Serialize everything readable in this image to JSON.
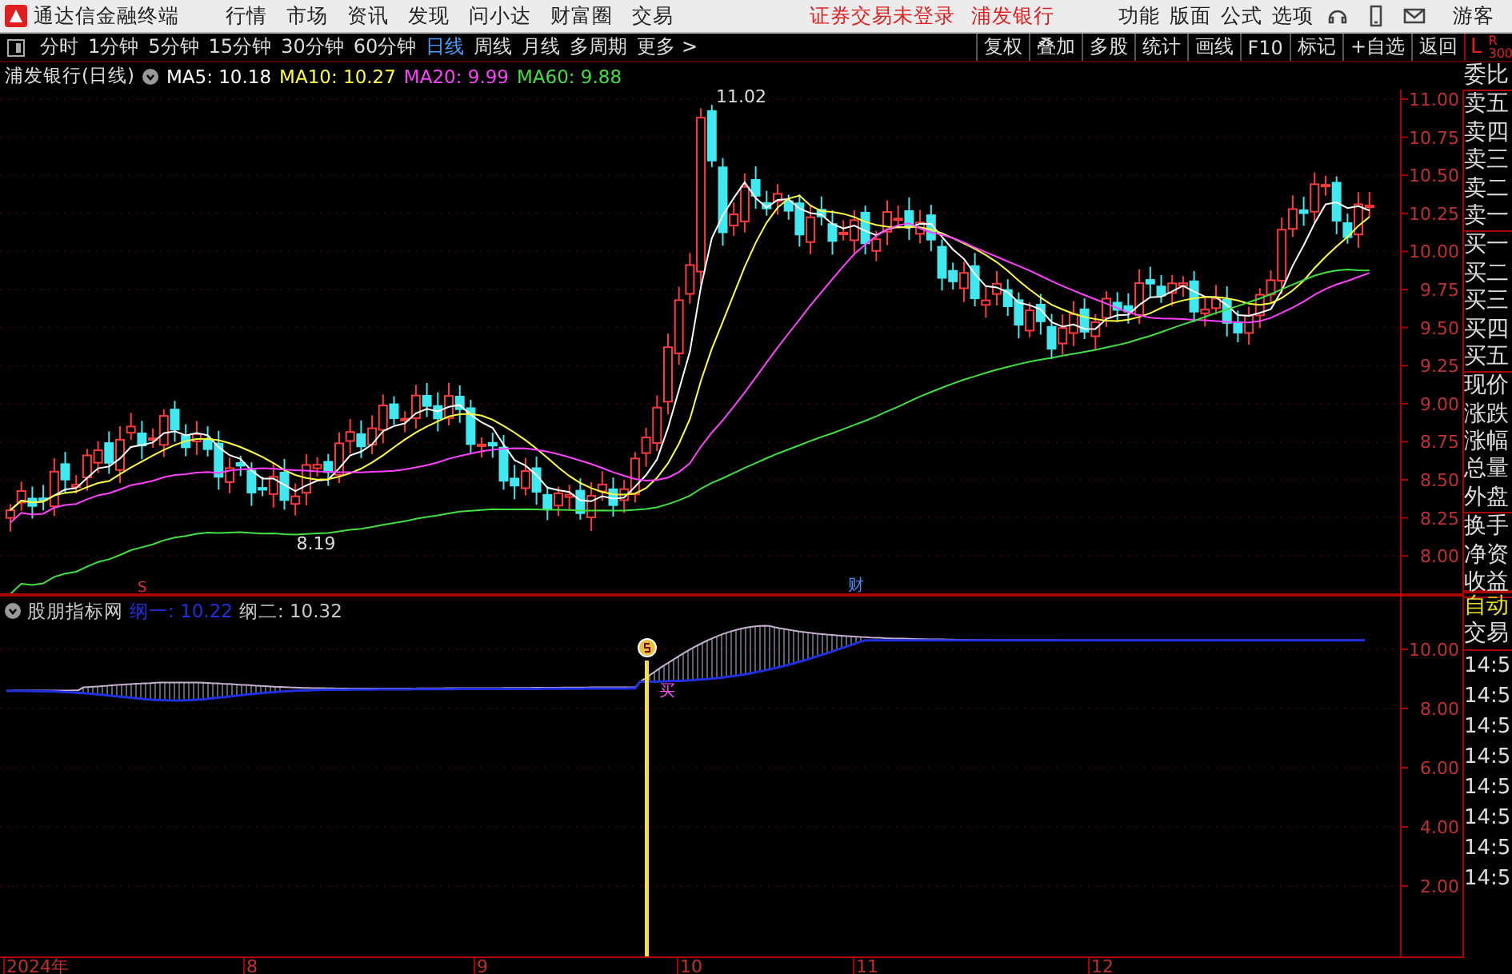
{
  "menubar": {
    "app_title": "通达信金融终端",
    "menus": [
      "行情",
      "市场",
      "资讯",
      "发现",
      "问小达",
      "财富圈",
      "交易"
    ],
    "status": [
      "证券交易未登录",
      "浦发银行"
    ],
    "right_menus": [
      "功能",
      "版面",
      "公式",
      "选项"
    ],
    "user": "游客"
  },
  "toolbar": {
    "periods": [
      {
        "label": "分时",
        "selected": false
      },
      {
        "label": "1分钟",
        "selected": false
      },
      {
        "label": "5分钟",
        "selected": false
      },
      {
        "label": "15分钟",
        "selected": false
      },
      {
        "label": "30分钟",
        "selected": false
      },
      {
        "label": "60分钟",
        "selected": false
      },
      {
        "label": "日线",
        "selected": true
      },
      {
        "label": "周线",
        "selected": false
      },
      {
        "label": "月线",
        "selected": false
      },
      {
        "label": "多周期",
        "selected": false
      },
      {
        "label": "更多 >",
        "selected": false
      }
    ],
    "buttons": [
      "复权",
      "叠加",
      "多股",
      "统计",
      "画线",
      "F10",
      "标记",
      "+自选",
      "返回"
    ],
    "corner": [
      "L",
      "R",
      "300"
    ]
  },
  "chart": {
    "title": "浦发银行(日线)",
    "averages": [
      {
        "label": "MA5: 10.18",
        "color": "#ffffff"
      },
      {
        "label": "MA10: 10.27",
        "color": "#ffff40"
      },
      {
        "label": "MA20: 9.99",
        "color": "#ff40ff"
      },
      {
        "label": "MA60: 9.88",
        "color": "#40e040"
      }
    ],
    "price_ticks": [
      "11.00",
      "10.75",
      "10.50",
      "10.25",
      "10.00",
      "9.75",
      "9.50",
      "9.25",
      "9.00",
      "8.75",
      "8.50",
      "8.25",
      "8.00"
    ],
    "high_label": "11.02",
    "low_label": "8.19",
    "markers": [
      "S",
      "财"
    ]
  },
  "sidebar": {
    "groups": [
      [
        "委比"
      ],
      [
        "卖五",
        "卖四",
        "卖三",
        "卖二",
        "卖一"
      ],
      [
        "买一",
        "买二",
        "买三",
        "买四",
        "买五"
      ],
      [
        "现价",
        "涨跌",
        "涨幅",
        "总量",
        "外盘"
      ],
      [
        "换手",
        "净资",
        "收益"
      ]
    ],
    "lower": [
      {
        "label": "自动",
        "kind": "accent"
      },
      {
        "label": "交易",
        "kind": "plain"
      }
    ],
    "times": [
      "14:5",
      "14:5",
      "14:5",
      "14:5",
      "14:5",
      "14:5",
      "14:5",
      "14:5"
    ]
  },
  "indicator": {
    "name": "股朋指标网",
    "lines": [
      {
        "label": "纲一: 10.22",
        "color": "#2030e0"
      },
      {
        "label": "纲二: 10.32",
        "color": "#c8c8c8"
      }
    ],
    "ticks": [
      "10.00",
      "8.00",
      "6.00",
      "4.00",
      "2.00"
    ],
    "signal": "买"
  },
  "time_axis": {
    "labels": [
      "2024年",
      "8",
      "9",
      "10",
      "11",
      "12"
    ]
  }
}
